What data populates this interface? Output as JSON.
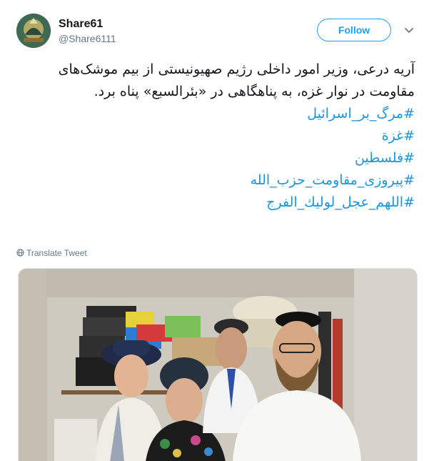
{
  "user": {
    "name": "Share61",
    "handle": "@Share6111"
  },
  "actions": {
    "follow_label": "Follow"
  },
  "tweet": {
    "text": "آریه درعی، وزیر امور داخلی رژیم صهیونیستی از بیم موشک‌های مقاومت در نوار غزه، به پناهگاهی در «بئرالسبع» پناه برد.",
    "hashtags": [
      "#مرگ_بر_اسرائیل",
      "#غزة",
      "#فلسطین",
      "#پیروزی_مقاومت_حزب_الله",
      "#اللهم_عجل_لولیك_الفرج"
    ],
    "translate_label": "Translate Tweet"
  },
  "colors": {
    "accent": "#1da1f2",
    "hashtag": "#1b95e0",
    "secondary_text": "#657786"
  }
}
